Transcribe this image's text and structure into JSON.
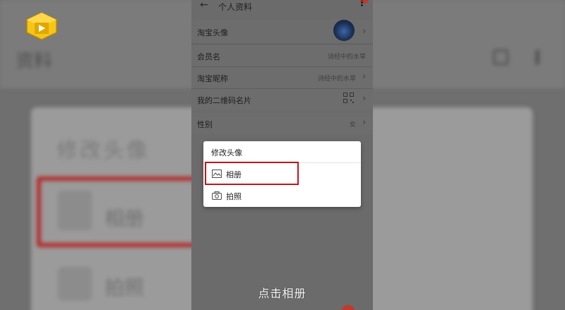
{
  "header": {
    "title": "个人资料",
    "back_label": "←"
  },
  "profile_rows": [
    {
      "label": "淘宝头像",
      "value": ""
    },
    {
      "label": "会员名",
      "value": "诗经中的水草"
    },
    {
      "label": "淘宝昵称",
      "value": "诗经中的水草"
    },
    {
      "label": "我的二维码名片",
      "value": ""
    },
    {
      "label": "性别",
      "value": "女"
    }
  ],
  "dialog": {
    "title": "修改头像",
    "options": [
      {
        "label": "相册",
        "icon": "image-icon"
      },
      {
        "label": "拍照",
        "icon": "camera-icon"
      }
    ]
  },
  "subtitle": "点击相册",
  "background": {
    "title": "资料",
    "card_title": "修改头像",
    "option1": "相册",
    "option2": "拍照"
  },
  "colors": {
    "highlight": "#c0161a",
    "dim_overlay": "#6b6b6b",
    "logo_yellow": "#f5c518"
  }
}
